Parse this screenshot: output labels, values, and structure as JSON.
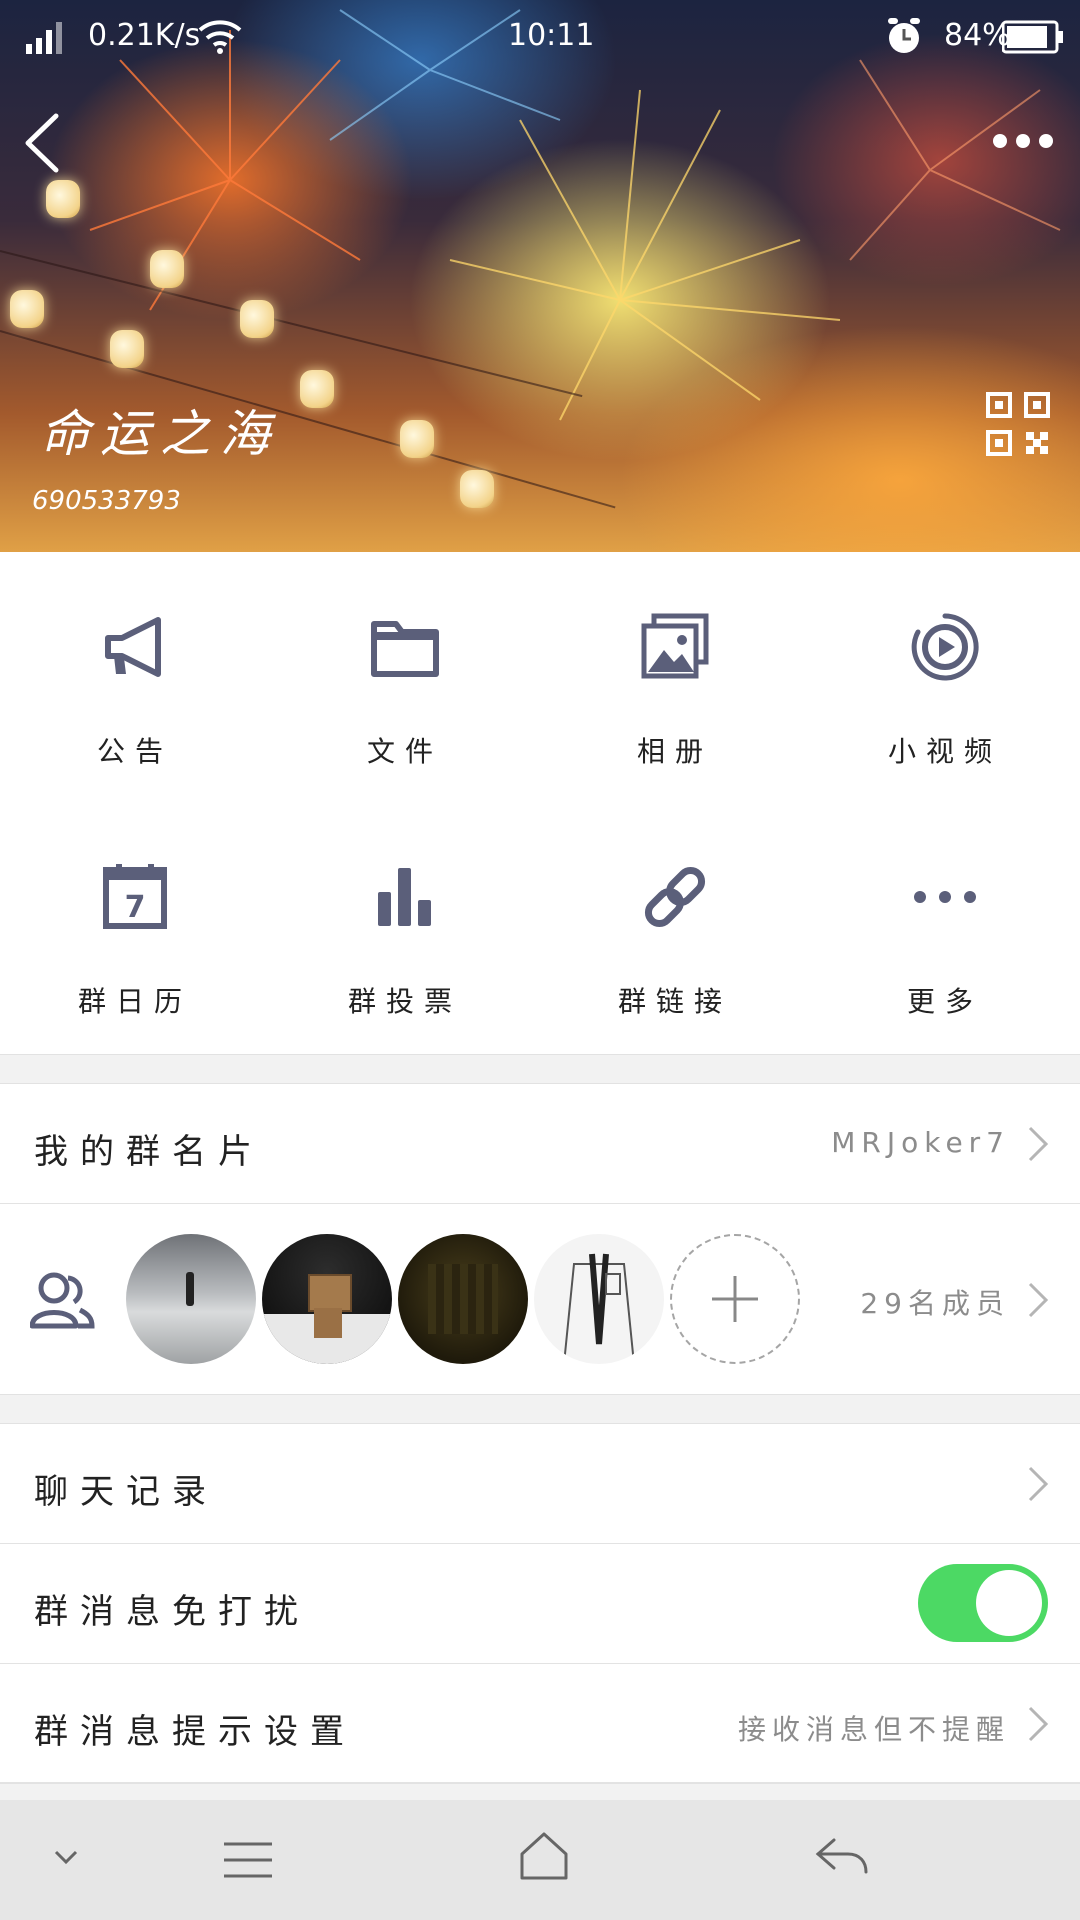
{
  "status_bar": {
    "network_speed": "0.21K/s",
    "time": "10:11",
    "battery": "84%"
  },
  "header": {
    "group_name": "命运之海",
    "group_id": "690533793"
  },
  "features": [
    {
      "label": "公告",
      "icon": "megaphone-icon"
    },
    {
      "label": "文件",
      "icon": "folder-icon"
    },
    {
      "label": "相册",
      "icon": "album-icon"
    },
    {
      "label": "小视频",
      "icon": "video-icon"
    },
    {
      "label": "群日历",
      "icon": "calendar-icon",
      "calendar_day": "7"
    },
    {
      "label": "群投票",
      "icon": "poll-icon"
    },
    {
      "label": "群链接",
      "icon": "link-icon"
    },
    {
      "label": "更多",
      "icon": "more-icon"
    }
  ],
  "card": {
    "label": "我的群名片",
    "value": "MRJoker7"
  },
  "members": {
    "count_text": "29名成员"
  },
  "settings": {
    "chat_history": "聊天记录",
    "mute_label": "群消息免打扰",
    "mute_on": true,
    "notify_label": "群消息提示设置",
    "notify_value": "接收消息但不提醒"
  },
  "colors": {
    "icon": "#5b5f7a",
    "toggle_on": "#4cd964",
    "nav_bg": "#e6e6e6"
  }
}
